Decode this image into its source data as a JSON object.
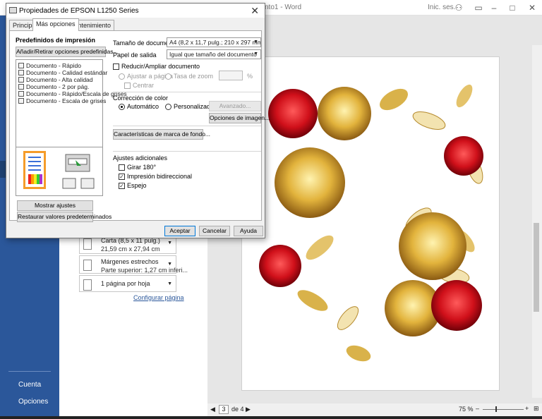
{
  "word": {
    "title": "nto1 - Word",
    "sign_in": "Inic. ses.",
    "backstage": {
      "account": "Cuenta",
      "options": "Opciones"
    },
    "settings": [
      {
        "line1": "Carta (8,5 x 11 pulg.)",
        "line2": "21,59 cm x 27,94 cm"
      },
      {
        "line1": "Márgenes estrechos",
        "line2": "Parte superior: 1,27 cm inferi..."
      },
      {
        "line1": "1 página por hoja",
        "line2": ""
      }
    ],
    "configure_page": "Configurar página",
    "status": {
      "page": "3",
      "of_pages": "de 4",
      "zoom": "75 %"
    }
  },
  "dialog": {
    "title": "Propiedades de EPSON L1250 Series",
    "close": "✕",
    "tabs": [
      "Principal",
      "Más opciones",
      "Mantenimiento"
    ],
    "presets_title": "Predefinidos de impresión",
    "presets_button": "Añadir/Retirar opciones predefinidas...",
    "presets": [
      "Documento - Rápido",
      "Documento - Calidad estándar",
      "Documento - Alta calidad",
      "Documento - 2 por pág.",
      "Documento - Rápido/Escala de grises",
      "Documento - Escala de grises"
    ],
    "show_settings": "Mostrar ajustes",
    "restore_defaults": "Restaurar valores predeterminados",
    "doc_size_label": "Tamaño de documento",
    "doc_size_value": "A4 (8,2 x 11,7 pulg.; 210 x 297 mm)",
    "output_paper_label": "Papel de salida",
    "output_paper_value": "Igual que tamaño del documento",
    "reduce_enlarge": "Reducir/Ampliar documento",
    "fit_page": "Ajustar a página",
    "zoom_rate": "Tasa de zoom",
    "percent": "%",
    "center": "Centrar",
    "color_correction": "Corrección de color",
    "auto": "Automático",
    "custom": "Personalizado",
    "advanced": "Avanzado...",
    "image_options": "Opciones de imagen...",
    "watermark": "Características de marca de fondo...",
    "extra_settings": "Ajustes adicionales",
    "rotate": "Girar 180°",
    "bidirectional": "Impresión bidireccional",
    "mirror": "Espejo",
    "accept": "Aceptar",
    "cancel": "Cancelar",
    "help": "Ayuda"
  }
}
